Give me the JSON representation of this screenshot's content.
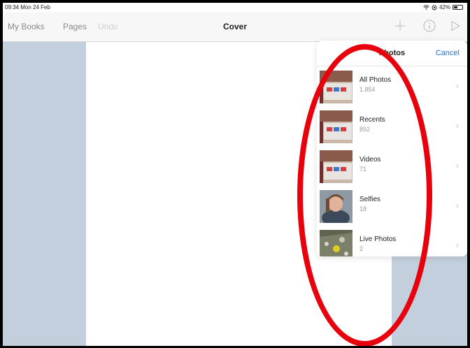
{
  "status": {
    "time": "09:34  Mon 24 Feb",
    "battery": "42%"
  },
  "nav": {
    "my_books": "My Books",
    "pages": "Pages",
    "undo": "Undo",
    "title": "Cover"
  },
  "popover": {
    "title": "Photos",
    "cancel": "Cancel",
    "albums": [
      {
        "name": "All Photos",
        "count": "1.854"
      },
      {
        "name": "Recents",
        "count": "892"
      },
      {
        "name": "Videos",
        "count": "71"
      },
      {
        "name": "Selfies",
        "count": "18"
      },
      {
        "name": "Live Photos",
        "count": "2"
      }
    ]
  },
  "colors": {
    "accent": "#1a73e8",
    "annotation": "#e8000d",
    "background": "#c3cfdc"
  }
}
